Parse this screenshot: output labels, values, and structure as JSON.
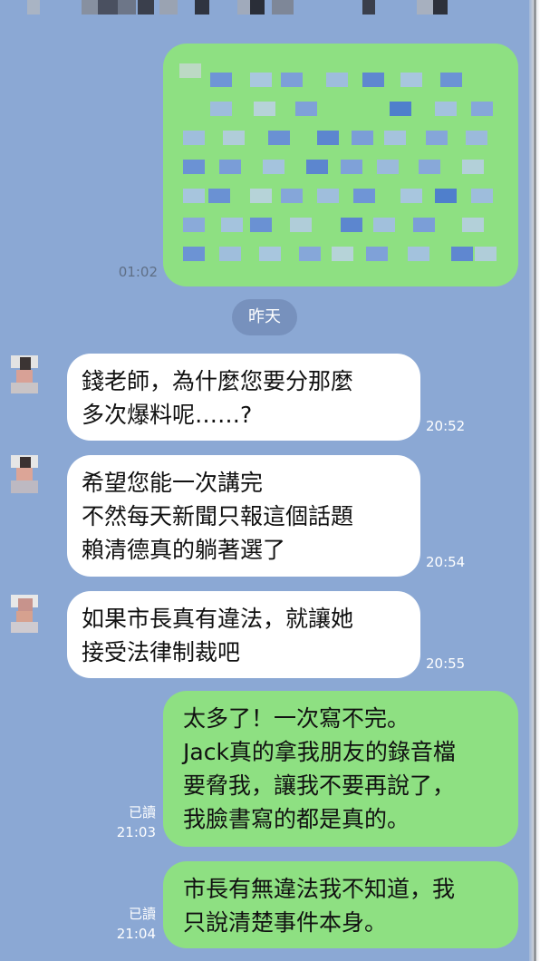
{
  "date_separator": "昨天",
  "colors": {
    "background": "#8ba8d4",
    "incoming_bubble": "#ffffff",
    "outgoing_bubble": "#8ee082",
    "date_chip": "#7791bd"
  },
  "messages": [
    {
      "direction": "out",
      "time": "01:02",
      "censored": true
    },
    {
      "direction": "in",
      "text": "錢老師，為什麼您要分那麼\n多次爆料呢……?",
      "time": "20:52"
    },
    {
      "direction": "in",
      "text": "希望您能一次講完\n不然每天新聞只報這個話題\n賴清德真的躺著選了",
      "time": "20:54"
    },
    {
      "direction": "in",
      "text": "如果市長真有違法，就讓她\n接受法律制裁吧",
      "time": "20:55"
    },
    {
      "direction": "out",
      "text": "太多了！一次寫不完。\nJack真的拿我朋友的錄音檔\n要脅我，讓我不要再說了，\n我臉書寫的都是真的。",
      "read": "已讀",
      "time": "21:03"
    },
    {
      "direction": "out",
      "text": "市長有無違法我不知道，我\n只說清楚事件本身。",
      "read": "已讀",
      "time": "21:04"
    }
  ]
}
